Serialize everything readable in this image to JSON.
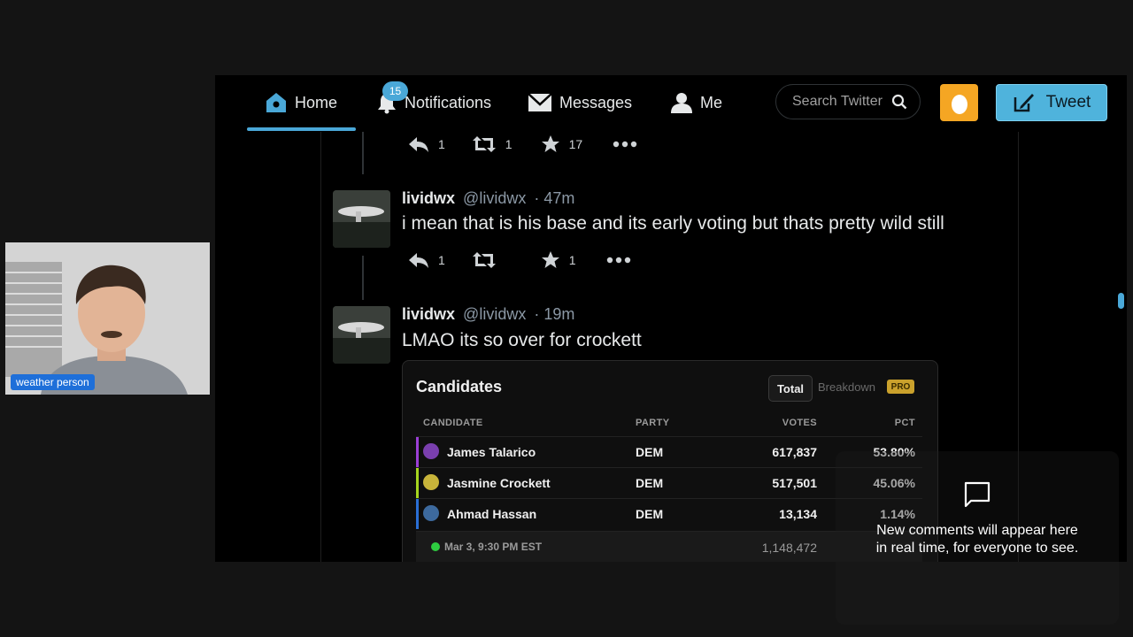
{
  "nav": {
    "home": "Home",
    "notifications": "Notifications",
    "notif_count": "15",
    "messages": "Messages",
    "me": "Me",
    "search_placeholder": "Search Twitter",
    "tweet_button": "Tweet"
  },
  "top_actions": {
    "reply": "1",
    "retweet": "1",
    "like": "17"
  },
  "tweets": [
    {
      "name": "lividwx",
      "handle": "@lividwx",
      "time": "· 47m",
      "text": "i mean that is his base and its early voting but thats pretty wild still",
      "actions": {
        "reply": "1",
        "retweet": "",
        "like": "1"
      }
    },
    {
      "name": "lividwx",
      "handle": "@lividwx",
      "time": "· 19m",
      "text": "LMAO its so over for crockett"
    }
  ],
  "card": {
    "title": "Candidates",
    "tab_total": "Total",
    "tab_breakdown": "Breakdown",
    "pro_badge": "PRO",
    "headers": {
      "candidate": "CANDIDATE",
      "party": "PARTY",
      "votes": "VOTES",
      "pct": "PCT"
    },
    "rows": [
      {
        "candidate": "James Talarico",
        "party": "DEM",
        "votes": "617,837",
        "pct": "53.80%",
        "color": "#9b3fd6"
      },
      {
        "candidate": "Jasmine Crockett",
        "party": "DEM",
        "votes": "517,501",
        "pct": "45.06%",
        "color": "#a6d61f"
      },
      {
        "candidate": "Ahmad Hassan",
        "party": "DEM",
        "votes": "13,134",
        "pct": "1.14%",
        "color": "#2a6fd6"
      }
    ],
    "footer_time": "Mar 3, 9:30 PM EST",
    "footer_total": "1,148,472"
  },
  "webcam": {
    "label": "weather person"
  },
  "comments": {
    "line1": "New comments will appear here",
    "line2": "in real time, for everyone to see."
  },
  "colors": {
    "accent": "#4aa8d8",
    "tweet_button": "#4fb3dc",
    "egg": "#f5a623",
    "pro": "#caa12c",
    "live": "#2ecc40"
  }
}
